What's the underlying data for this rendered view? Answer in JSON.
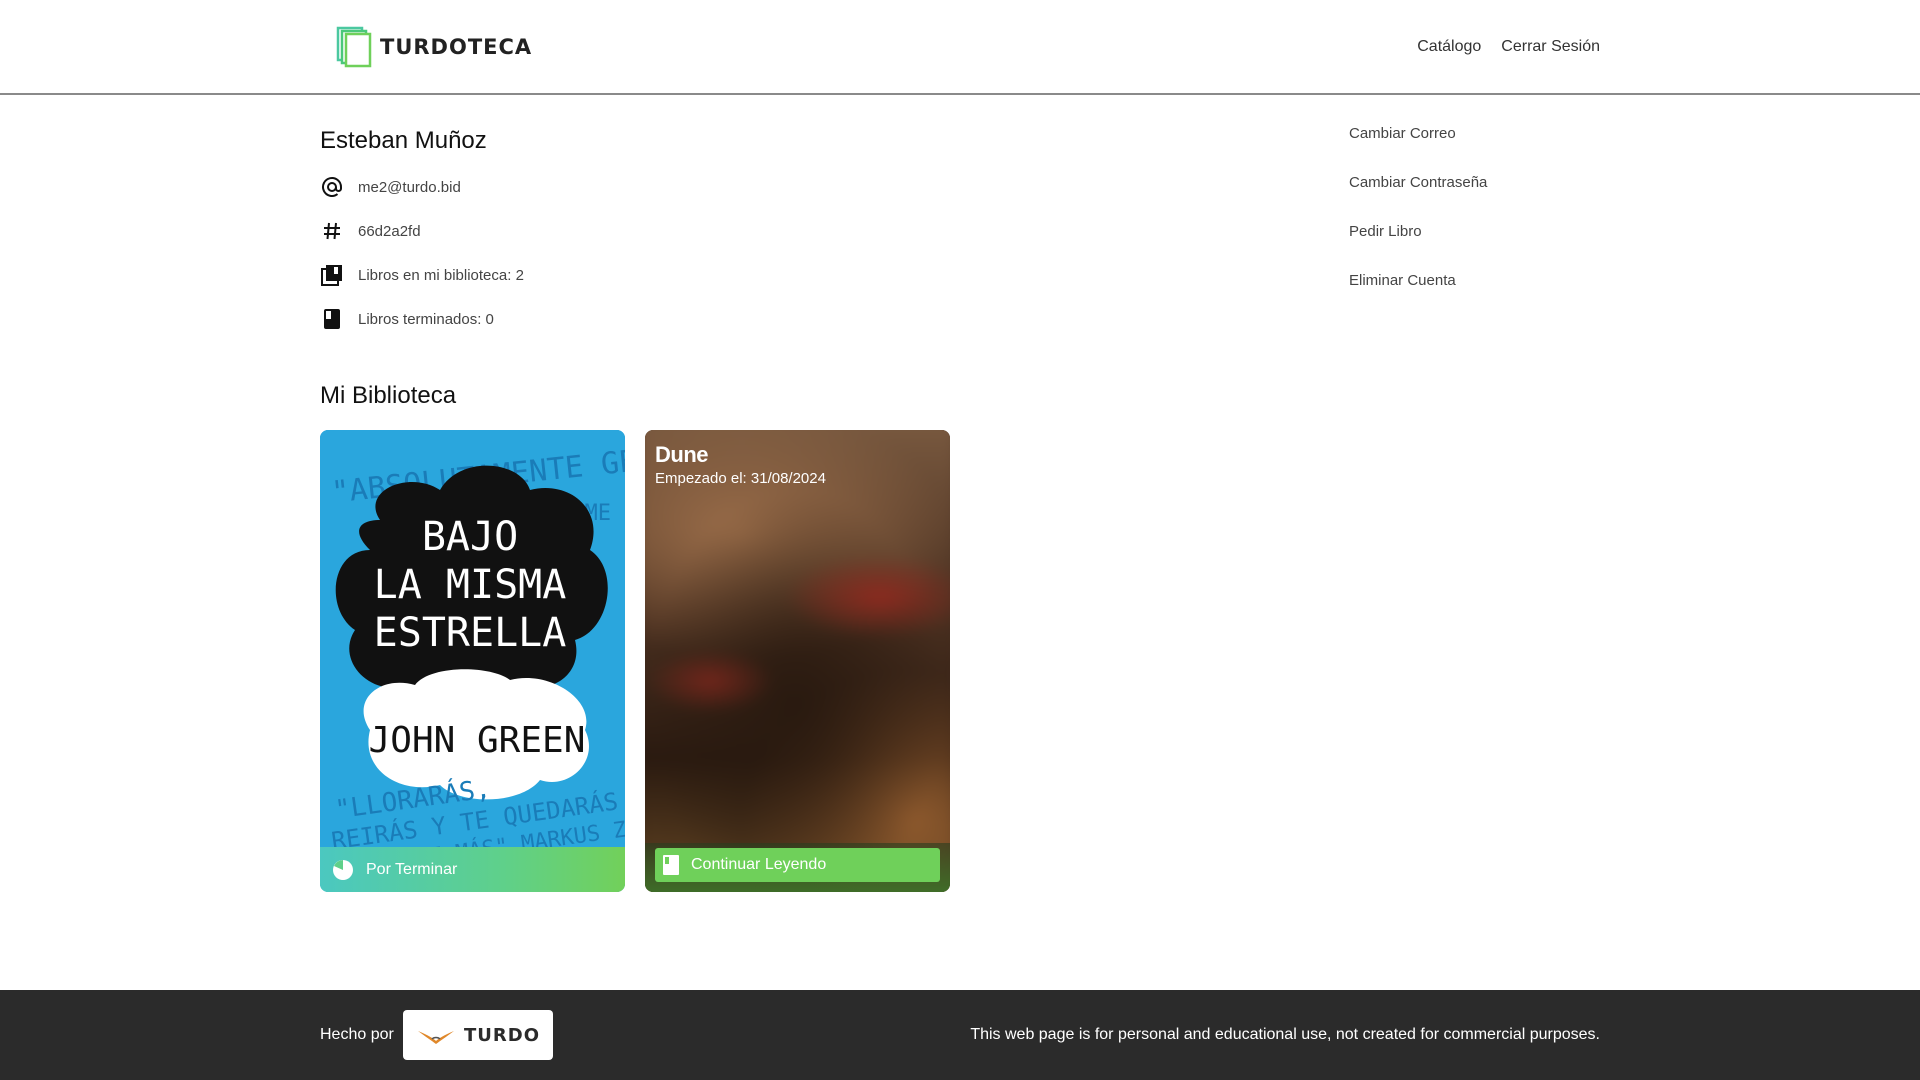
{
  "header": {
    "logo_text": "TURDOTECA",
    "nav": [
      {
        "label": "Catálogo"
      },
      {
        "label": "Cerrar Sesión"
      }
    ]
  },
  "profile": {
    "name": "Esteban Muñoz",
    "email": "me2@turdo.bid",
    "id": "66d2a2fd",
    "books_in_library": "Libros en mi biblioteca: 2",
    "books_finished": "Libros terminados: 0"
  },
  "side_menu": [
    {
      "label": "Cambiar Correo"
    },
    {
      "label": "Cambiar Contraseña"
    },
    {
      "label": "Pedir Libro"
    },
    {
      "label": "Eliminar Cuenta"
    }
  ],
  "library": {
    "title": "Mi Biblioteca",
    "books": [
      {
        "cover_quote_top": "\"ABSOLUTAMENTE GENIAL\"",
        "cover_source": "TIME",
        "cover_title": [
          "BAJO",
          "LA MISMA",
          "ESTRELLA"
        ],
        "cover_author": "JOHN GREEN",
        "cover_quote_bottom": [
          "\"LLORARÁS,",
          "REIRÁS Y TE QUEDARÁS CON",
          "GANAS DE MÁS\" MARKUS ZUSAK"
        ],
        "status": "Por Terminar"
      },
      {
        "title": "Dune",
        "started": "Empezado el: 31/08/2024",
        "action": "Continuar Leyendo"
      }
    ]
  },
  "footer": {
    "made_by": "Hecho por",
    "brand": "TURDO",
    "disclaimer": "This web page is for personal and educational use, not created for commercial purposes."
  },
  "colors": {
    "accent_green": "#6fd05a",
    "teal": "#4bc8c0",
    "footer_bg": "#2b2b2b",
    "cover_blue": "#2aa6dd"
  }
}
